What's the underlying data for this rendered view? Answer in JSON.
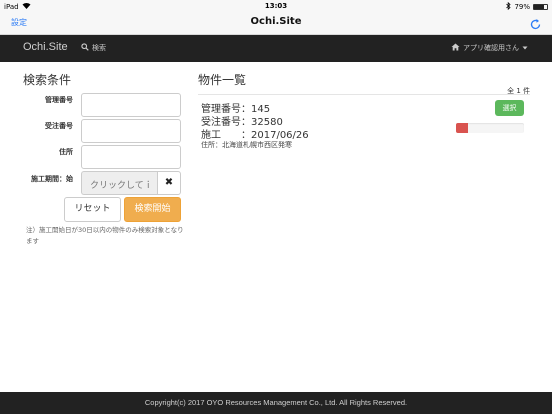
{
  "status_bar": {
    "device": "iPad",
    "time": "13:03",
    "battery": "79%",
    "battery_level": 0.79
  },
  "nav_bar": {
    "back_label": "設定",
    "title": "Ochi.Site"
  },
  "site_header": {
    "brand": "Ochi.Site",
    "search_link": "検索",
    "user_menu": "アプリ確認用さん"
  },
  "search_panel": {
    "heading": "検索条件",
    "fields": {
      "kanri_label": "管理番号",
      "kanri_value": "",
      "juchu_label": "受注番号",
      "juchu_value": "",
      "address_label": "住所",
      "address_value": "",
      "date_label": "施工期間：始",
      "date_placeholder": "クリックしてｉ"
    },
    "reset_button": "リセット",
    "search_button": "検索開始",
    "note": "注）施工開始日が30日以内の物件のみ検索対象となります"
  },
  "result_panel": {
    "heading": "物件一覧",
    "count": "全 1 件",
    "items": [
      {
        "kanri": "管理番号：145",
        "juchu": "受注番号：32580",
        "sekou": "施工　　：2017/06/26",
        "address": "住所：北海道札幌市西区発寒",
        "select_label": "選択",
        "progress": 0.18
      }
    ]
  },
  "footer": {
    "copyright": "Copyright(c) 2017 OYO Resources Management Co., Ltd. All Rights Reserved."
  },
  "colors": {
    "ios_blue": "#2d7cf6",
    "header_bg": "#222222",
    "select_green": "#5cb85c",
    "search_orange": "#f0ad4e",
    "progress_red": "#d9534f"
  },
  "icons": [
    "wifi-icon",
    "bluetooth-icon",
    "battery-icon",
    "reload-icon",
    "search-icon",
    "home-icon",
    "caret-down-icon",
    "close-icon"
  ]
}
